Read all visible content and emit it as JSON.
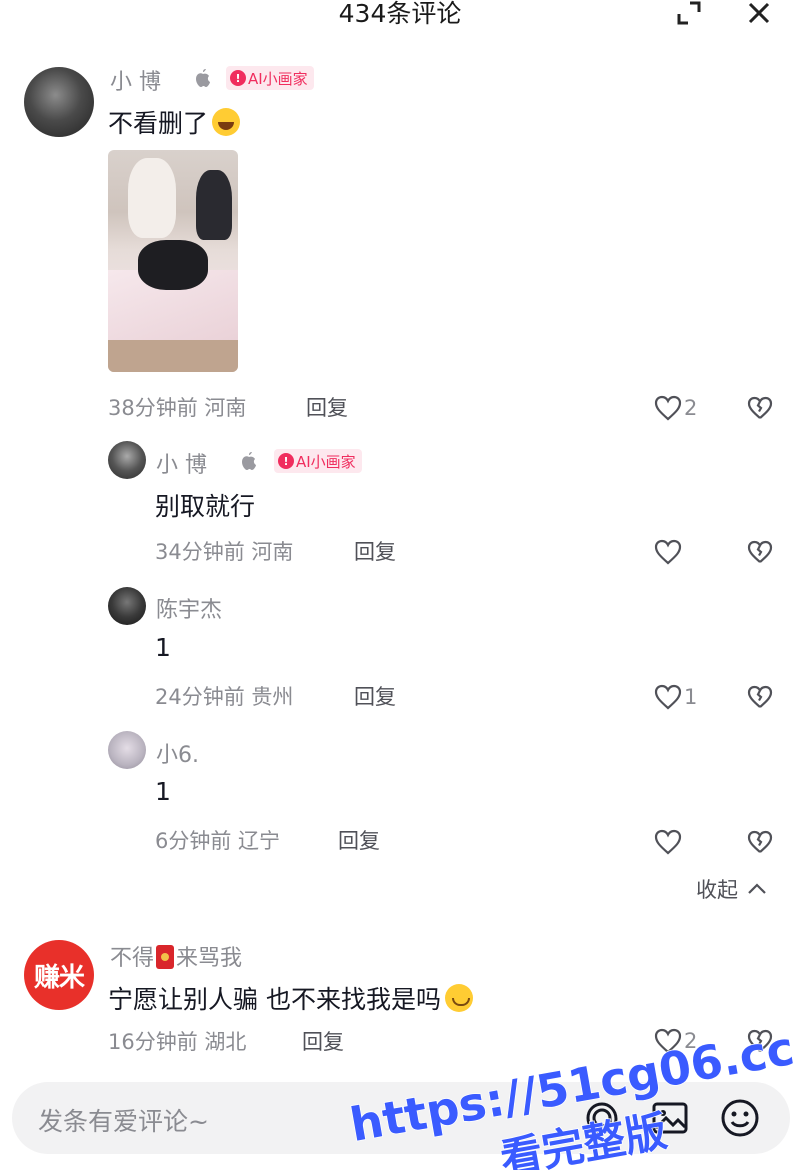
{
  "header": {
    "title": "434条评论"
  },
  "comments": [
    {
      "name": "小 博",
      "badge": "AI小画家",
      "text": "不看删了",
      "meta": "38分钟前 河南",
      "reply_label": "回复",
      "likes": "2",
      "replies": [
        {
          "name": "小 博",
          "badge": "AI小画家",
          "text": "别取就行",
          "meta": "34分钟前 河南",
          "reply_label": "回复",
          "likes": ""
        },
        {
          "name": "陈宇杰",
          "text": "1",
          "meta": "24分钟前 贵州",
          "reply_label": "回复",
          "likes": "1"
        },
        {
          "name": "小6.",
          "text": "1",
          "meta": "6分钟前 辽宁",
          "reply_label": "回复",
          "likes": ""
        }
      ],
      "collapse_label": "收起"
    },
    {
      "name_part1": "不得",
      "name_part2": "来骂我",
      "avatar_text": "赚米",
      "text": "宁愿让别人骗 也不来找我是吗",
      "meta": "16分钟前 湖北",
      "reply_label": "回复",
      "likes": "2"
    }
  ],
  "input": {
    "placeholder": "发条有爱评论~"
  },
  "watermark": {
    "line1": "https://51cg06.cc",
    "line2": "看完整版"
  },
  "colors": {
    "accent": "#f02d5e",
    "muted": "#8a8b91",
    "text": "#161823",
    "watermark": "#3a5bff"
  },
  "icons": [
    "expand-icon",
    "close-icon",
    "apple-icon",
    "heart-icon",
    "broken-heart-icon",
    "chevron-up-icon",
    "at-icon",
    "image-icon",
    "emoji-icon"
  ]
}
